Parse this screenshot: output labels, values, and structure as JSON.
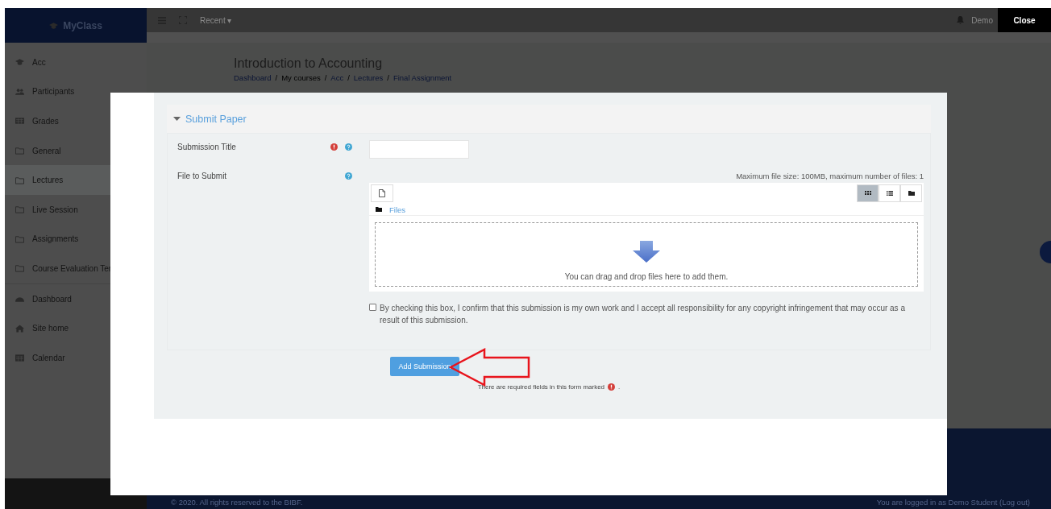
{
  "brand": {
    "name": "MyClass"
  },
  "navbar": {
    "recent": "Recent ▾",
    "user": "Demo"
  },
  "close_button": "Close",
  "sidebar": {
    "items": [
      {
        "label": "Acc",
        "kind": "course",
        "selected": false,
        "divider_after": false
      },
      {
        "label": "Participants",
        "kind": "people",
        "selected": false,
        "divider_after": false
      },
      {
        "label": "Grades",
        "kind": "grades",
        "selected": false,
        "divider_after": false
      },
      {
        "label": "General",
        "kind": "section",
        "selected": false,
        "divider_after": false
      },
      {
        "label": "Lectures",
        "kind": "section",
        "selected": true,
        "divider_after": false
      },
      {
        "label": "Live Session",
        "kind": "section",
        "selected": false,
        "divider_after": false
      },
      {
        "label": "Assignments",
        "kind": "section",
        "selected": false,
        "divider_after": false
      },
      {
        "label": "Course Evaluation Ter",
        "kind": "section",
        "selected": false,
        "divider_after": true
      },
      {
        "label": "Dashboard",
        "kind": "dashboard",
        "selected": false,
        "divider_after": false
      },
      {
        "label": "Site home",
        "kind": "home",
        "selected": false,
        "divider_after": false
      },
      {
        "label": "Calendar",
        "kind": "calendar",
        "selected": false,
        "divider_after": false
      }
    ]
  },
  "page": {
    "title": "Introduction to Accounting",
    "separator": "/",
    "breadcrumb": [
      {
        "label": "Dashboard",
        "link": true
      },
      {
        "label": "My courses",
        "link": false
      },
      {
        "label": "Acc",
        "link": true
      },
      {
        "label": "Lectures",
        "link": true
      },
      {
        "label": "Final Assignment",
        "link": true
      }
    ]
  },
  "footer": {
    "copyright": "© 2020. All rights reserved to the BIBF.",
    "login": "You are logged in as Demo Student (Log out)"
  },
  "modal": {
    "section_title": "Submit Paper",
    "expanded": true,
    "fields": [
      {
        "label": "Submission Title",
        "kind": "text",
        "required": true
      },
      {
        "label": "File to Submit",
        "kind": "files",
        "required": false
      }
    ],
    "file_limits": "Maximum file size: 100MB, maximum number of files: 1",
    "folder": "Files",
    "views": [
      {
        "kind": "icons",
        "selected": true
      },
      {
        "kind": "list",
        "selected": false
      },
      {
        "kind": "tree",
        "selected": false
      }
    ],
    "drop_hint": "You can drag and drop files here to add them.",
    "confirm": {
      "text": "By checking this box, I confirm that this submission is my own work and I accept all responsibility for any copyright infringement that may occur as a result of this submission.",
      "checked": false
    },
    "submit_button": "Add Submission",
    "required_note": {
      "before": "There are required fields in this form marked",
      "after": "."
    }
  }
}
